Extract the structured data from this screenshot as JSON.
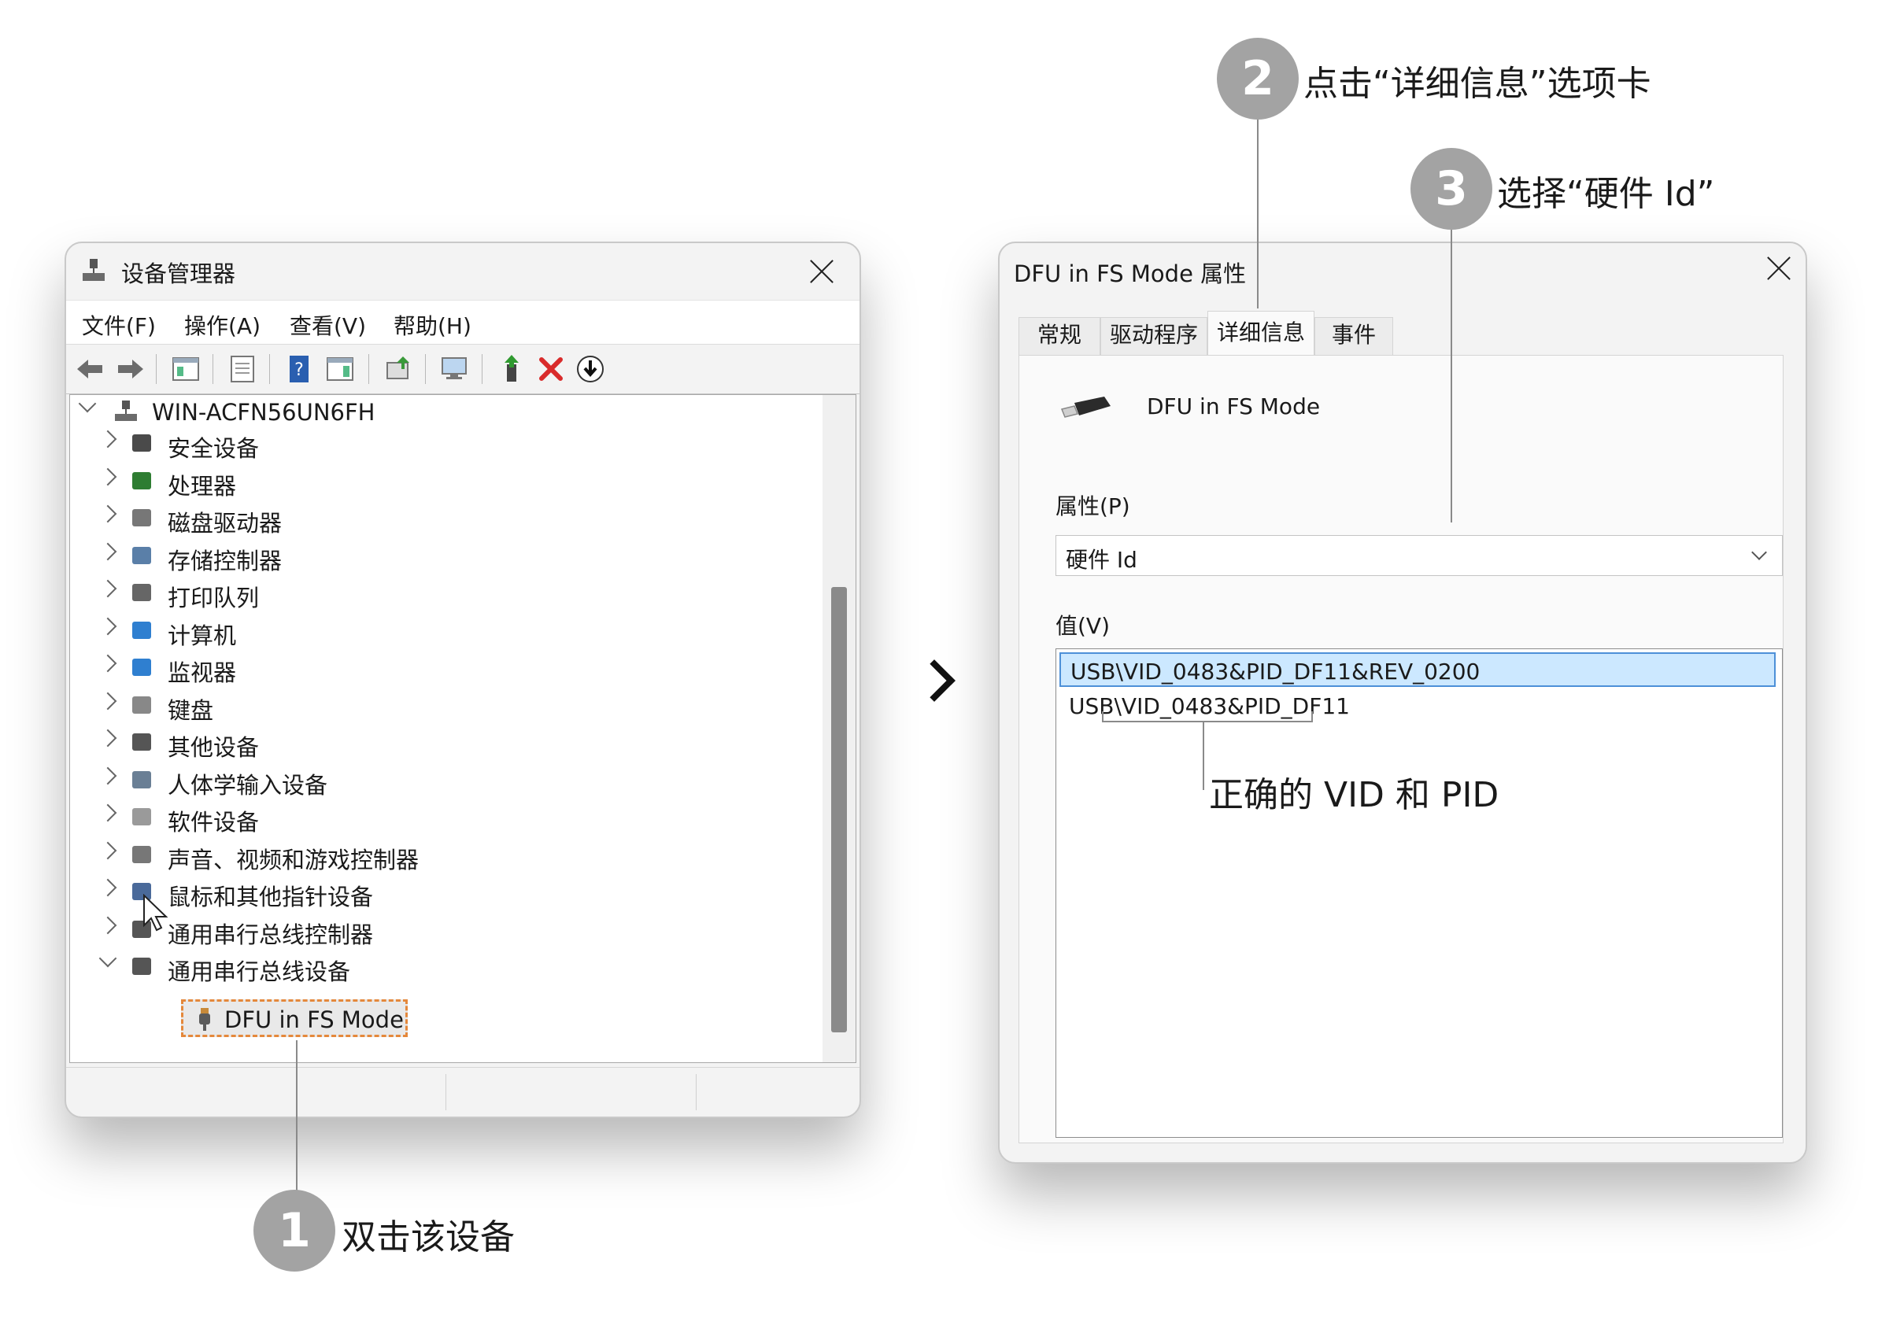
{
  "device_manager": {
    "title": "设备管理器",
    "menu": [
      "文件(F)",
      "操作(A)",
      "查看(V)",
      "帮助(H)"
    ],
    "root": "WIN-ACFN56UN6FH",
    "categories": [
      {
        "label": "安全设备",
        "icon": "security-device-icon"
      },
      {
        "label": "处理器",
        "icon": "processor-icon"
      },
      {
        "label": "磁盘驱动器",
        "icon": "disk-drive-icon"
      },
      {
        "label": "存储控制器",
        "icon": "storage-controller-icon"
      },
      {
        "label": "打印队列",
        "icon": "printer-icon"
      },
      {
        "label": "计算机",
        "icon": "computer-icon"
      },
      {
        "label": "监视器",
        "icon": "monitor-icon"
      },
      {
        "label": "键盘",
        "icon": "keyboard-icon"
      },
      {
        "label": "其他设备",
        "icon": "other-device-icon"
      },
      {
        "label": "人体学输入设备",
        "icon": "hid-icon"
      },
      {
        "label": "软件设备",
        "icon": "software-device-icon"
      },
      {
        "label": "声音、视频和游戏控制器",
        "icon": "speaker-icon"
      },
      {
        "label": "鼠标和其他指针设备",
        "icon": "mouse-icon"
      },
      {
        "label": "通用串行总线控制器",
        "icon": "usb-icon"
      },
      {
        "label": "通用串行总线设备",
        "icon": "usb-icon"
      }
    ],
    "child_device": "DFU in FS Mode"
  },
  "properties": {
    "title": "DFU in FS Mode 属性",
    "tabs": [
      "常规",
      "驱动程序",
      "详细信息",
      "事件"
    ],
    "active_tab": "详细信息",
    "device_name": "DFU in FS Mode",
    "property_label": "属性(P)",
    "property_value": "硬件 Id",
    "value_label": "值(V)",
    "values": [
      "USB\\VID_0483&PID_DF11&REV_0200",
      "USB\\VID_0483&PID_DF11"
    ]
  },
  "annotations": {
    "step1_number": "1",
    "step1_text": "双击该设备",
    "step2_number": "2",
    "step2_text": "点击“详细信息”选项卡",
    "step3_number": "3",
    "step3_text": "选择“硬件 Id”",
    "vid_pid_note": "正确的 VID 和 PID"
  },
  "colors": {
    "accent_dashed": "#e4883b",
    "selection": "#cce8ff",
    "step_circle": "#a3a3a3",
    "delete_red": "#d92b2b"
  }
}
